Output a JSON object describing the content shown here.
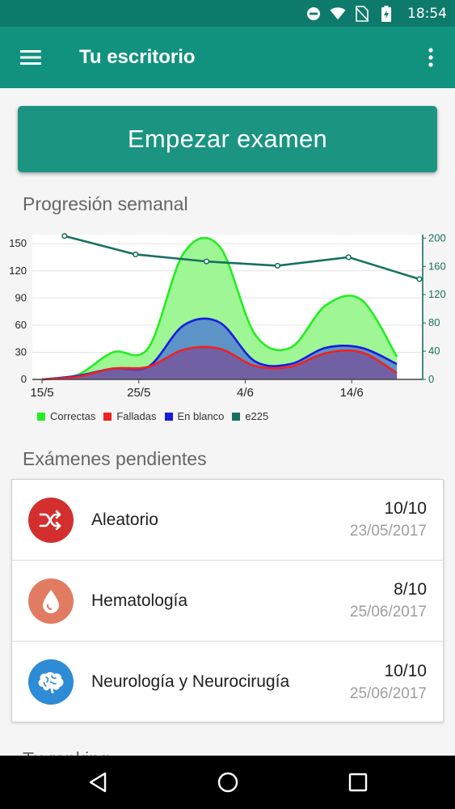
{
  "status_bar": {
    "time": "18:54",
    "icons": [
      "do-not-disturb-icon",
      "wifi-icon",
      "no-sim-icon",
      "battery-charging-icon"
    ]
  },
  "app_bar": {
    "title": "Tu escritorio",
    "menu_icon": "hamburger-menu-icon",
    "overflow_icon": "more-vert-icon"
  },
  "start_button": {
    "label": "Empezar examen"
  },
  "progress_section": {
    "title": "Progresión semanal"
  },
  "chart_data": {
    "type": "area",
    "x_ticks": [
      "15/5",
      "25/5",
      "4/6",
      "14/6"
    ],
    "x": [
      0,
      1,
      2,
      3,
      4,
      5,
      6,
      7,
      8,
      9,
      10
    ],
    "y_left_ticks": [
      0,
      30,
      60,
      90,
      120,
      150
    ],
    "y_right_ticks": [
      0,
      40,
      80,
      120,
      160,
      200
    ],
    "ylim_left": [
      0,
      160
    ],
    "ylim_right": [
      0,
      205
    ],
    "series": [
      {
        "name": "Correctas",
        "axis": "left",
        "color": "#22ee22",
        "fill": "#99f58e",
        "values": [
          0,
          5,
          30,
          35,
          140,
          147,
          50,
          35,
          82,
          88,
          25
        ]
      },
      {
        "name": "Falladas",
        "axis": "left",
        "color": "#ee2222",
        "fill": null,
        "values": [
          0,
          3,
          12,
          14,
          33,
          34,
          15,
          14,
          29,
          30,
          7
        ]
      },
      {
        "name": "En blanco",
        "axis": "left",
        "color": "#1a1ae0",
        "fill": "#5a8ec9",
        "values": [
          0,
          4,
          12,
          14,
          60,
          63,
          20,
          17,
          35,
          35,
          17
        ]
      },
      {
        "name": "e225",
        "axis": "right",
        "color": "#17705f",
        "fill": null,
        "points": [
          [
            1,
            203
          ],
          [
            3,
            177
          ],
          [
            5,
            167
          ],
          [
            7,
            161
          ],
          [
            9,
            173
          ],
          [
            11,
            142
          ]
        ]
      }
    ],
    "legend_placement": "bottom-left",
    "grid": true
  },
  "pending_section": {
    "title": "Exámenes pendientes",
    "exams": [
      {
        "name": "Aleatorio",
        "score": "10/10",
        "date": "23/05/2017",
        "icon": "shuffle-icon",
        "color": "#d32f2f"
      },
      {
        "name": "Hematología",
        "score": "8/10",
        "date": "25/06/2017",
        "icon": "blood-drop-icon",
        "color": "#e17c63"
      },
      {
        "name": "Neurología y Neurocirugía",
        "score": "10/10",
        "date": "25/06/2017",
        "icon": "brain-icon",
        "color": "#2e8bd6"
      }
    ]
  },
  "ranking_section": {
    "title": "Tu ranking"
  },
  "nav_bar": {
    "icons": [
      "back-icon",
      "home-icon",
      "recents-icon"
    ]
  }
}
